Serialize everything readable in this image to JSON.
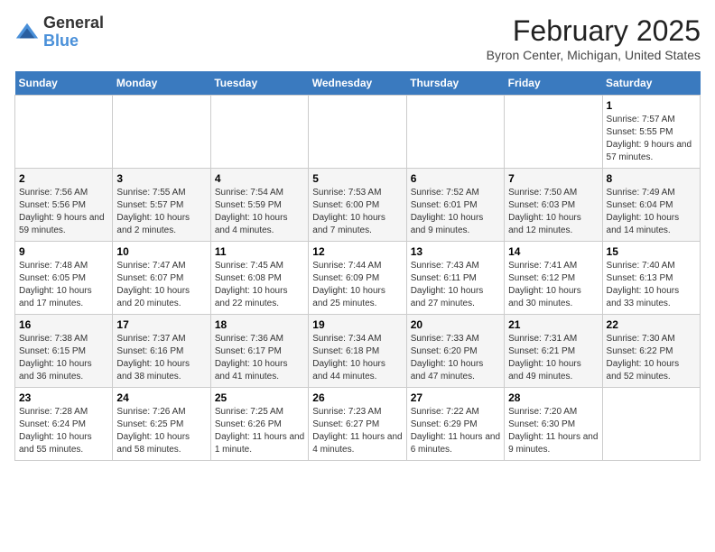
{
  "header": {
    "logo_general": "General",
    "logo_blue": "Blue",
    "month_year": "February 2025",
    "location": "Byron Center, Michigan, United States"
  },
  "weekdays": [
    "Sunday",
    "Monday",
    "Tuesday",
    "Wednesday",
    "Thursday",
    "Friday",
    "Saturday"
  ],
  "weeks": [
    [
      {
        "day": "",
        "info": ""
      },
      {
        "day": "",
        "info": ""
      },
      {
        "day": "",
        "info": ""
      },
      {
        "day": "",
        "info": ""
      },
      {
        "day": "",
        "info": ""
      },
      {
        "day": "",
        "info": ""
      },
      {
        "day": "1",
        "info": "Sunrise: 7:57 AM\nSunset: 5:55 PM\nDaylight: 9 hours and 57 minutes."
      }
    ],
    [
      {
        "day": "2",
        "info": "Sunrise: 7:56 AM\nSunset: 5:56 PM\nDaylight: 9 hours and 59 minutes."
      },
      {
        "day": "3",
        "info": "Sunrise: 7:55 AM\nSunset: 5:57 PM\nDaylight: 10 hours and 2 minutes."
      },
      {
        "day": "4",
        "info": "Sunrise: 7:54 AM\nSunset: 5:59 PM\nDaylight: 10 hours and 4 minutes."
      },
      {
        "day": "5",
        "info": "Sunrise: 7:53 AM\nSunset: 6:00 PM\nDaylight: 10 hours and 7 minutes."
      },
      {
        "day": "6",
        "info": "Sunrise: 7:52 AM\nSunset: 6:01 PM\nDaylight: 10 hours and 9 minutes."
      },
      {
        "day": "7",
        "info": "Sunrise: 7:50 AM\nSunset: 6:03 PM\nDaylight: 10 hours and 12 minutes."
      },
      {
        "day": "8",
        "info": "Sunrise: 7:49 AM\nSunset: 6:04 PM\nDaylight: 10 hours and 14 minutes."
      }
    ],
    [
      {
        "day": "9",
        "info": "Sunrise: 7:48 AM\nSunset: 6:05 PM\nDaylight: 10 hours and 17 minutes."
      },
      {
        "day": "10",
        "info": "Sunrise: 7:47 AM\nSunset: 6:07 PM\nDaylight: 10 hours and 20 minutes."
      },
      {
        "day": "11",
        "info": "Sunrise: 7:45 AM\nSunset: 6:08 PM\nDaylight: 10 hours and 22 minutes."
      },
      {
        "day": "12",
        "info": "Sunrise: 7:44 AM\nSunset: 6:09 PM\nDaylight: 10 hours and 25 minutes."
      },
      {
        "day": "13",
        "info": "Sunrise: 7:43 AM\nSunset: 6:11 PM\nDaylight: 10 hours and 27 minutes."
      },
      {
        "day": "14",
        "info": "Sunrise: 7:41 AM\nSunset: 6:12 PM\nDaylight: 10 hours and 30 minutes."
      },
      {
        "day": "15",
        "info": "Sunrise: 7:40 AM\nSunset: 6:13 PM\nDaylight: 10 hours and 33 minutes."
      }
    ],
    [
      {
        "day": "16",
        "info": "Sunrise: 7:38 AM\nSunset: 6:15 PM\nDaylight: 10 hours and 36 minutes."
      },
      {
        "day": "17",
        "info": "Sunrise: 7:37 AM\nSunset: 6:16 PM\nDaylight: 10 hours and 38 minutes."
      },
      {
        "day": "18",
        "info": "Sunrise: 7:36 AM\nSunset: 6:17 PM\nDaylight: 10 hours and 41 minutes."
      },
      {
        "day": "19",
        "info": "Sunrise: 7:34 AM\nSunset: 6:18 PM\nDaylight: 10 hours and 44 minutes."
      },
      {
        "day": "20",
        "info": "Sunrise: 7:33 AM\nSunset: 6:20 PM\nDaylight: 10 hours and 47 minutes."
      },
      {
        "day": "21",
        "info": "Sunrise: 7:31 AM\nSunset: 6:21 PM\nDaylight: 10 hours and 49 minutes."
      },
      {
        "day": "22",
        "info": "Sunrise: 7:30 AM\nSunset: 6:22 PM\nDaylight: 10 hours and 52 minutes."
      }
    ],
    [
      {
        "day": "23",
        "info": "Sunrise: 7:28 AM\nSunset: 6:24 PM\nDaylight: 10 hours and 55 minutes."
      },
      {
        "day": "24",
        "info": "Sunrise: 7:26 AM\nSunset: 6:25 PM\nDaylight: 10 hours and 58 minutes."
      },
      {
        "day": "25",
        "info": "Sunrise: 7:25 AM\nSunset: 6:26 PM\nDaylight: 11 hours and 1 minute."
      },
      {
        "day": "26",
        "info": "Sunrise: 7:23 AM\nSunset: 6:27 PM\nDaylight: 11 hours and 4 minutes."
      },
      {
        "day": "27",
        "info": "Sunrise: 7:22 AM\nSunset: 6:29 PM\nDaylight: 11 hours and 6 minutes."
      },
      {
        "day": "28",
        "info": "Sunrise: 7:20 AM\nSunset: 6:30 PM\nDaylight: 11 hours and 9 minutes."
      },
      {
        "day": "",
        "info": ""
      }
    ]
  ]
}
